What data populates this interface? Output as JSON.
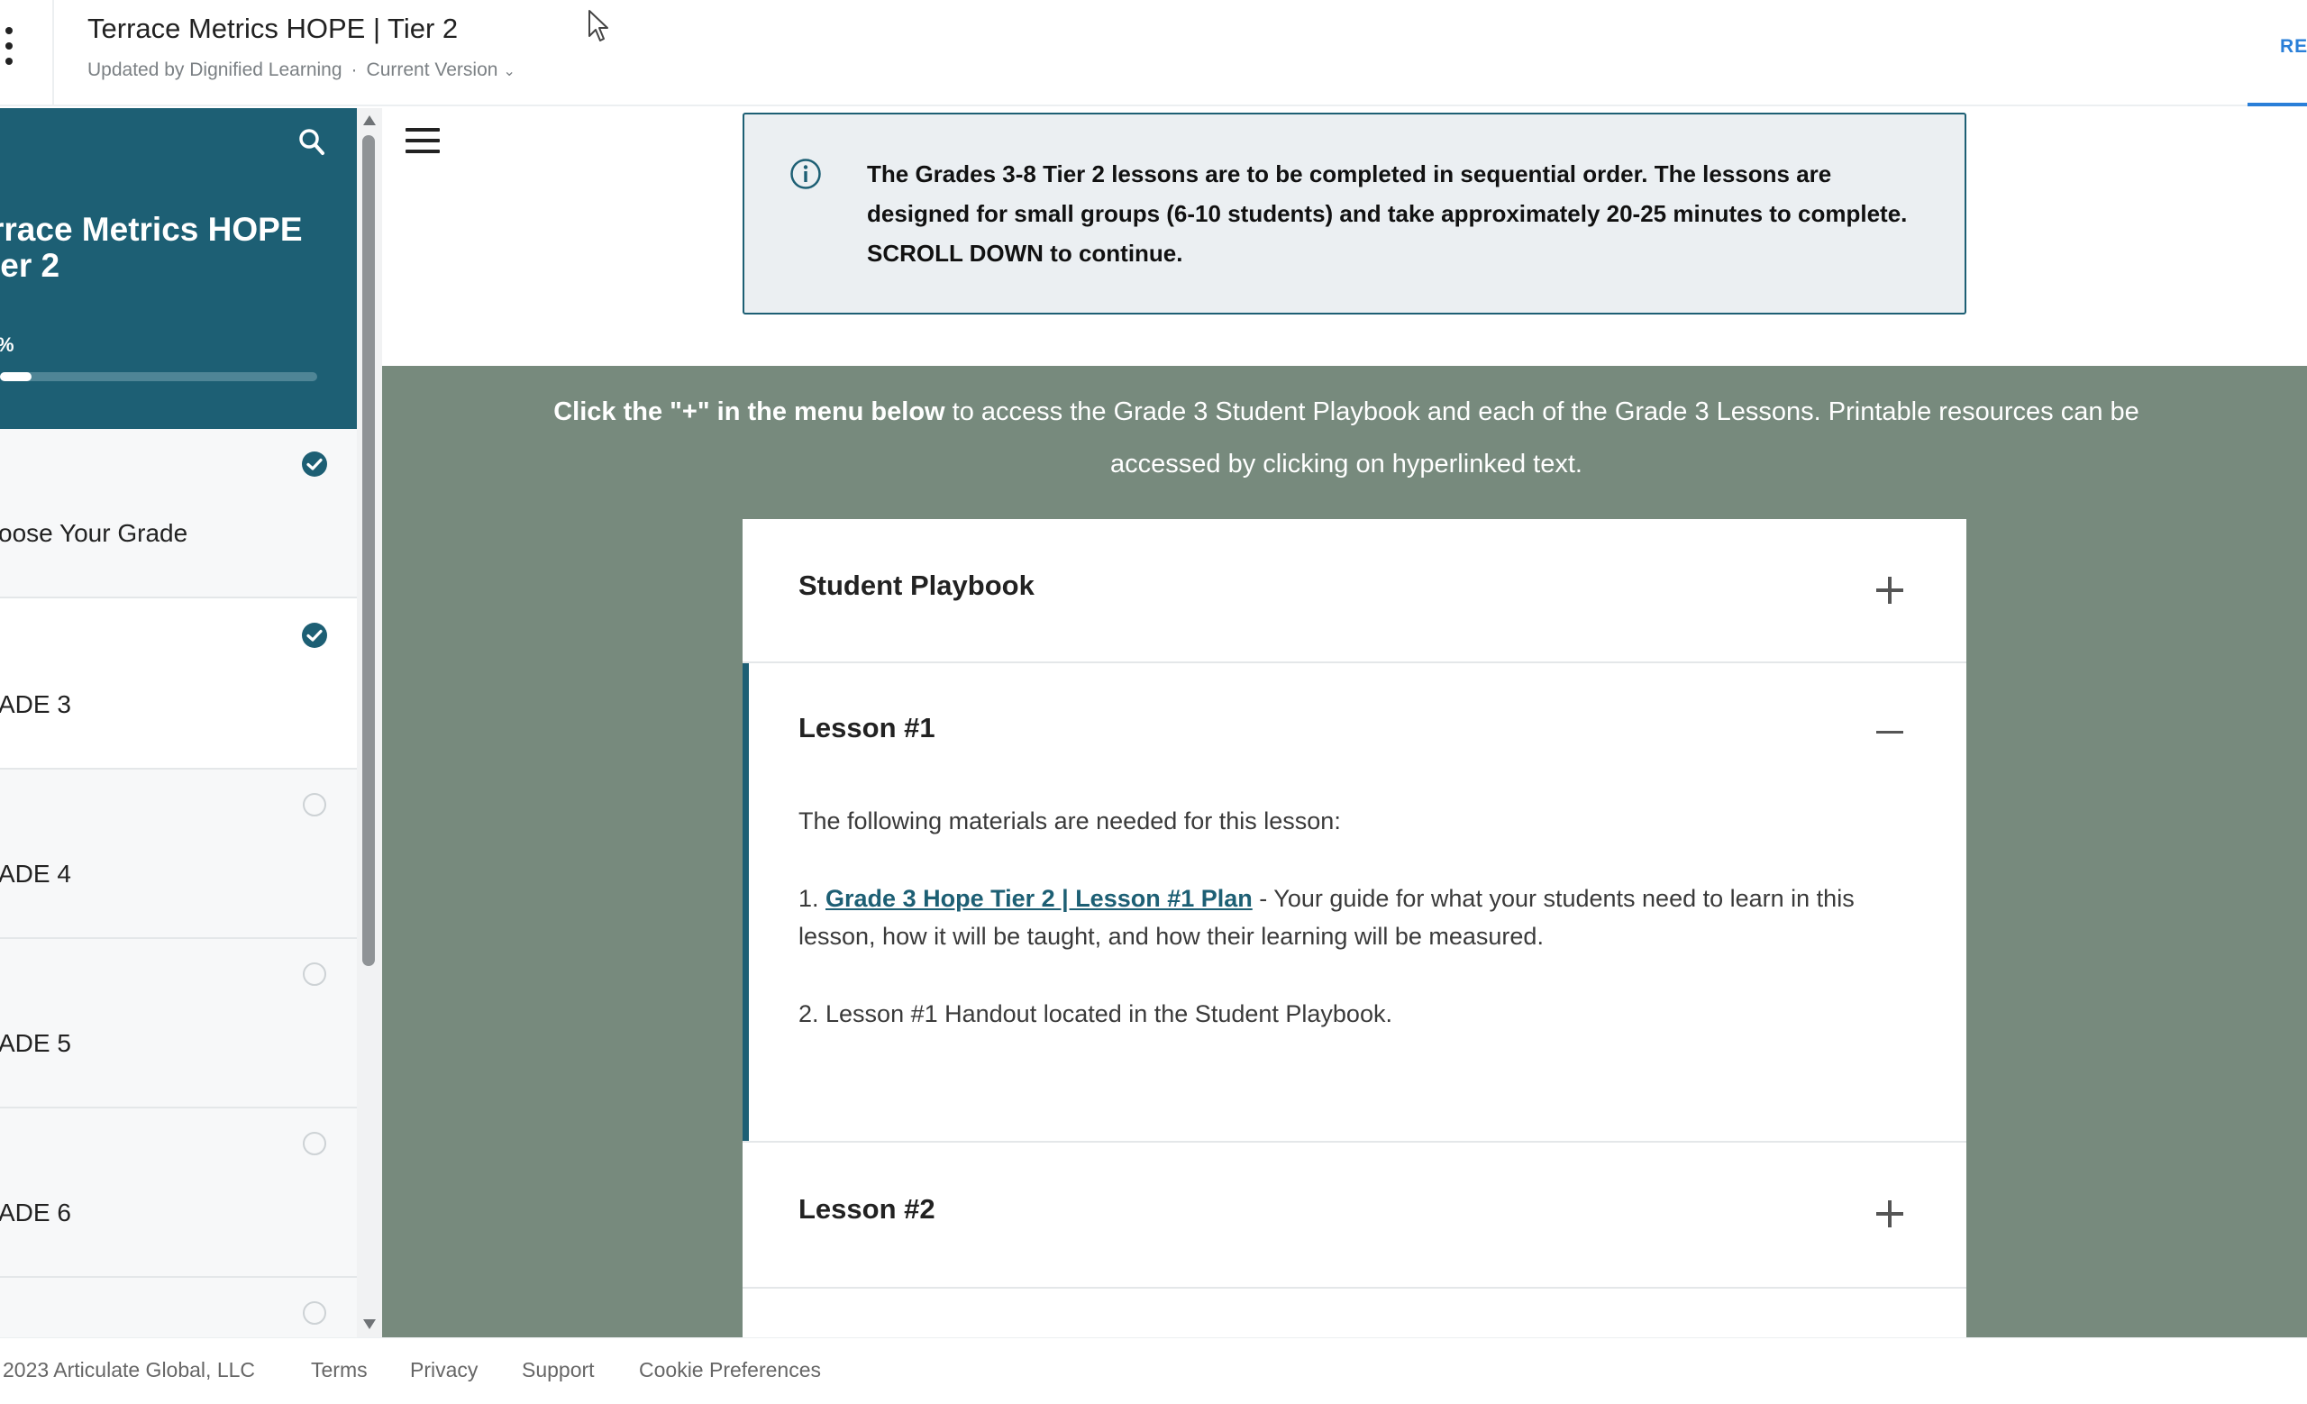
{
  "header": {
    "title": "Terrace Metrics HOPE | Tier 2",
    "updated_by": "Updated by Dignified Learning",
    "version_label": "Current Version",
    "right_link": "RE"
  },
  "sidebar": {
    "title_line1": "rrace Metrics HOPE",
    "title_line2": "ier 2",
    "progress_label": "%",
    "progress_fraction": 0.1,
    "items": [
      {
        "label": "oose Your Grade",
        "status": "complete"
      },
      {
        "label": "ADE 3",
        "status": "complete"
      },
      {
        "label": "ADE 4",
        "status": "incomplete"
      },
      {
        "label": "ADE 5",
        "status": "incomplete"
      },
      {
        "label": "ADE 6",
        "status": "incomplete"
      },
      {
        "label": "",
        "status": "incomplete"
      }
    ]
  },
  "notice": {
    "text": "The Grades 3-8 Tier 2 lessons are to be completed in sequential order. The lessons are designed for small groups (6-10 students) and take approximately 20-25 minutes to complete. SCROLL DOWN to continue."
  },
  "intro": {
    "bold": "Click the \"+\" in the menu below",
    "rest": " to access the Grade 3 Student Playbook and each of the Grade 3 Lessons. Printable resources can be accessed by clicking on hyperlinked text."
  },
  "accordion": {
    "items": [
      {
        "title": "Student Playbook",
        "state": "collapsed"
      },
      {
        "title": "Lesson #1",
        "state": "expanded",
        "intro": "The following materials are needed for this lesson:",
        "item1_prefix": "1. ",
        "item1_link": "Grade 3 Hope Tier 2 | Lesson #1 Plan",
        "item1_rest": " - Your guide for what your students need to learn in this lesson, how it will be taught, and how their learning will be measured.",
        "item2": "2. Lesson #1 Handout located in the Student Playbook."
      },
      {
        "title": "Lesson #2",
        "state": "collapsed"
      }
    ]
  },
  "footer": {
    "copyright": "2023 Articulate Global, LLC",
    "links": [
      "Terms",
      "Privacy",
      "Support",
      "Cookie Preferences"
    ]
  },
  "colors": {
    "brand": "#1d5f74",
    "band": "#778a7d",
    "notice_bg": "#ebeff2",
    "link_blue": "#2a7fd8"
  }
}
